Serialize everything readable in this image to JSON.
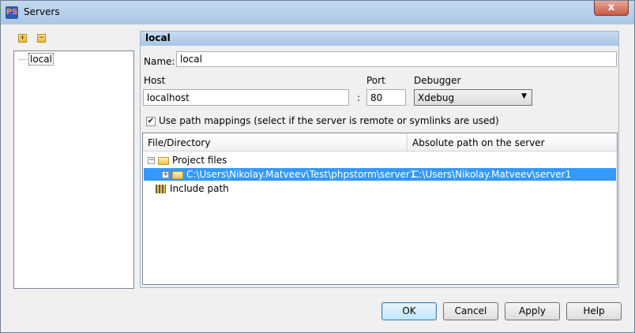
{
  "window": {
    "title": "Servers",
    "app_icon": "phpstorm-icon",
    "close_label": "x"
  },
  "toolbar": {
    "add_icon": "add-icon",
    "remove_icon": "remove-icon"
  },
  "server_list": {
    "items": [
      {
        "label": "local"
      }
    ]
  },
  "detail": {
    "header": "local",
    "name_label": "Name:",
    "name_value": "local",
    "host_label": "Host",
    "host_value": "localhost",
    "colon": ":",
    "port_label": "Port",
    "port_value": "80",
    "debugger_label": "Debugger",
    "debugger_value": "Xdebug",
    "path_mappings_checked": true,
    "path_mappings_label": "Use path mappings (select if the server is remote or symlinks are used)"
  },
  "mappings": {
    "columns": [
      "File/Directory",
      "Absolute path on the server"
    ],
    "project_files_label": "Project files",
    "rows": [
      {
        "file": "C:\\Users\\Nikolay.Matveev\\Test\\phpstorm\\server1",
        "server_path": "C:\\Users\\Nikolay.Matveev\\server1"
      }
    ],
    "include_path_label": "Include path"
  },
  "buttons": {
    "ok": "OK",
    "cancel": "Cancel",
    "apply": "Apply",
    "help": "Help"
  },
  "colors": {
    "selection": "#3399ff",
    "header_bg": "#a7c4e6"
  }
}
